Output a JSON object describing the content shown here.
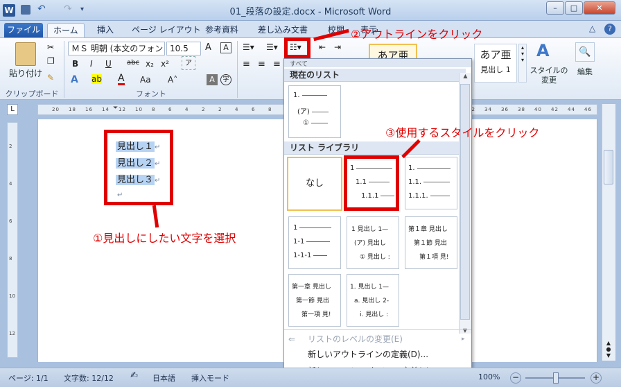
{
  "window": {
    "title": "01_段落の設定.docx - Microsoft Word",
    "app_icon": "W",
    "qat_icons": [
      "save-icon",
      "undo-icon",
      "redo-icon",
      "customize-icon"
    ],
    "min": "–",
    "max": "□",
    "close": "✕"
  },
  "tabs": [
    "ファイル",
    "ホーム",
    "挿入",
    "ページ レイアウト",
    "参考資料",
    "差し込み文書",
    "校閲",
    "表示"
  ],
  "ribbon": {
    "paste_label": "貼り付け",
    "clipboard_group": "クリップボード",
    "font_group": "フォント",
    "font_name": "ＭＳ 明朝 (本文のフォン",
    "font_size": "10.5",
    "bold": "B",
    "italic": "I",
    "underline": "U",
    "strike": "abc",
    "subscript": "x₂",
    "superscript": "x²",
    "style_normal": "あア亜",
    "style_h1_sample": "あア亜",
    "style_h1_label": "見出し 1",
    "change_styles_label": "スタイルの\n変更",
    "editing_label": "編集",
    "help_icon": "?"
  },
  "document": {
    "headings": [
      "見出し１",
      "見出し２",
      "見出し３"
    ],
    "para_mark": "↵"
  },
  "annotations": {
    "step1": "①見出しにしたい文字を選択",
    "step2": "②アウトラインをクリック",
    "step3": "③使用するスタイルをクリック"
  },
  "dropdown": {
    "header_all": "すべて",
    "section_current": "現在のリスト",
    "section_library": "リスト ライブラリ",
    "none_label": "なし",
    "current_rows": [
      "1.",
      "(ア)",
      "①"
    ],
    "styles": [
      {
        "rows": [
          "1",
          "1.1",
          "1.1.1"
        ]
      },
      {
        "rows": [
          "1.",
          "1.1.",
          "1.1.1."
        ]
      },
      {
        "rows": [
          "1",
          "1-1",
          "1-1-1"
        ]
      },
      {
        "rows": [
          "1 見出し 1—",
          "(ア) 見出し",
          "① 見出し :"
        ]
      },
      {
        "rows": [
          "第１章 見出し",
          "第１節 見出",
          "第１項 見!"
        ]
      },
      {
        "rows": [
          "第一章 見出し",
          "第一節 見出",
          "第一項 見!"
        ]
      },
      {
        "rows": [
          "1. 見出し 1—",
          "a. 見出し 2-",
          "i. 見出し :"
        ]
      }
    ],
    "menu": [
      {
        "label": "リストのレベルの変更(E)",
        "disabled": true
      },
      {
        "label": "新しいアウトラインの定義(D)...",
        "disabled": false
      },
      {
        "label": "新しいリスト スタイルの定義(L)...",
        "disabled": false
      }
    ]
  },
  "ruler": {
    "h_ticks": [
      "20",
      "18",
      "16",
      "14",
      "12",
      "10",
      "8",
      "6",
      "4",
      "2",
      "2",
      "4",
      "6",
      "8",
      "10",
      "12",
      "14",
      "16",
      "18",
      "20",
      "22",
      "24",
      "26",
      "28",
      "30",
      "32",
      "34",
      "36",
      "38",
      "40",
      "42",
      "44",
      "46"
    ],
    "v_ticks": [
      "2",
      "4",
      "6",
      "8",
      "10",
      "12"
    ]
  },
  "status": {
    "page": "ページ: 1/1",
    "words": "文字数: 12/12",
    "lang": "日本語",
    "mode": "挿入モード",
    "zoom": "100%"
  }
}
